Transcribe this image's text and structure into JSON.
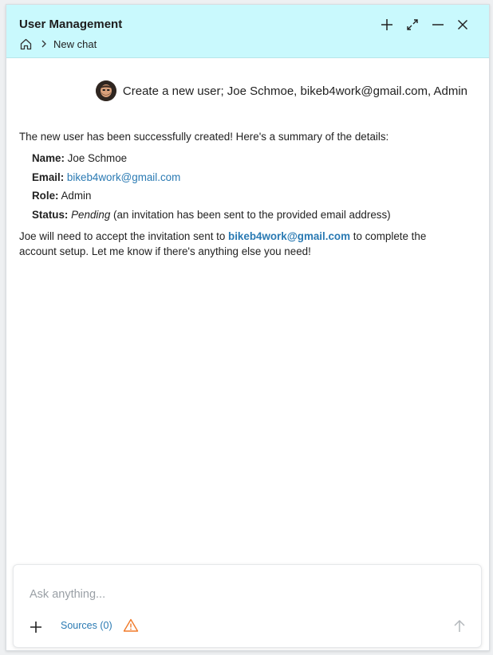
{
  "window": {
    "title": "User Management",
    "breadcrumb": {
      "current": "New chat"
    }
  },
  "icons": {
    "new": "plus-icon",
    "expand": "expand-icon",
    "minimize": "minimize-icon",
    "close": "close-icon",
    "home": "home-icon",
    "separator": "chevron-right-icon",
    "attach": "plus-icon",
    "warning": "warning-icon",
    "send": "arrow-up-icon"
  },
  "colors": {
    "header_bg": "#c9f9fd",
    "link": "#2a7ab3",
    "warning": "#f07a2a"
  },
  "chat": {
    "user_message": "Create a new user; Joe Schmoe, bikeb4work@gmail.com, Admin",
    "assistant": {
      "intro": "The new user has been successfully created! Here's a summary of the details:",
      "details": [
        {
          "label": "Name:",
          "value": "Joe Schmoe"
        },
        {
          "label": "Email:",
          "value": "bikeb4work@gmail.com"
        },
        {
          "label": "Role:",
          "value": "Admin"
        },
        {
          "label": "Status:",
          "value_em": "Pending",
          "value": " (an invitation has been sent to the provided email address)"
        }
      ],
      "closing_before": "Joe will need to accept the invitation sent to ",
      "closing_email": "bikeb4work@gmail.com",
      "closing_after": " to complete the account setup. Let me know if there's anything else you need!"
    }
  },
  "composer": {
    "placeholder": "Ask anything...",
    "value": "",
    "sources_label": "Sources (0)"
  }
}
